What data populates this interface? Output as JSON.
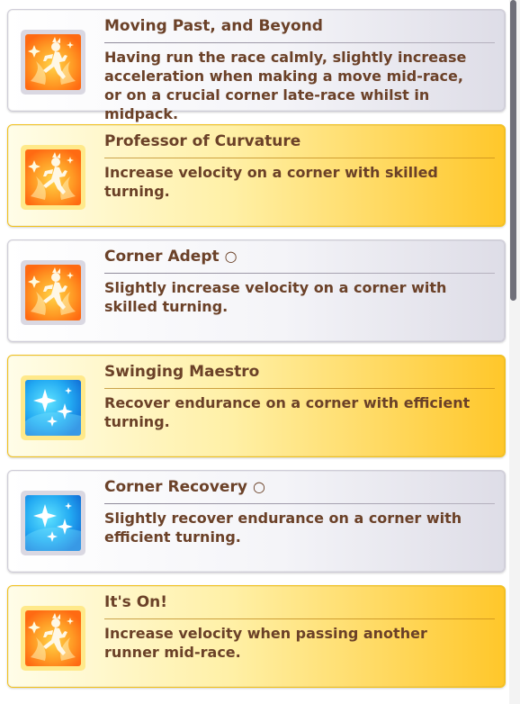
{
  "skills": [
    {
      "name": "Moving Past, and Beyond",
      "grade": "",
      "description": "Having run the race calmly, slightly increase acceleration when making a move mid-race, or on a crucial corner late-race whilst in midpack.",
      "rarity": "normal",
      "icon": "speed-runner-icon"
    },
    {
      "name": "Professor of Curvature",
      "grade": "",
      "description": "Increase velocity on a corner with skilled turning.",
      "rarity": "gold",
      "icon": "speed-runner-icon"
    },
    {
      "name": "Corner Adept",
      "grade": "○",
      "description": "Slightly increase velocity on a corner with skilled turning.",
      "rarity": "normal",
      "icon": "speed-runner-icon"
    },
    {
      "name": "Swinging Maestro",
      "grade": "",
      "description": "Recover endurance on a corner with efficient turning.",
      "rarity": "gold",
      "icon": "recovery-sparkle-icon"
    },
    {
      "name": "Corner Recovery",
      "grade": "○",
      "description": "Slightly recover endurance on a corner with efficient turning.",
      "rarity": "normal",
      "icon": "recovery-sparkle-icon"
    },
    {
      "name": "It's On!",
      "grade": "",
      "description": "Increase velocity when passing another runner mid-race.",
      "rarity": "gold",
      "icon": "speed-runner-icon"
    }
  ],
  "colors": {
    "text": "#6b4128",
    "gold": "#ffc72a",
    "speed_icon": "#ff8a1c",
    "recovery_icon": "#1a8fe8"
  }
}
